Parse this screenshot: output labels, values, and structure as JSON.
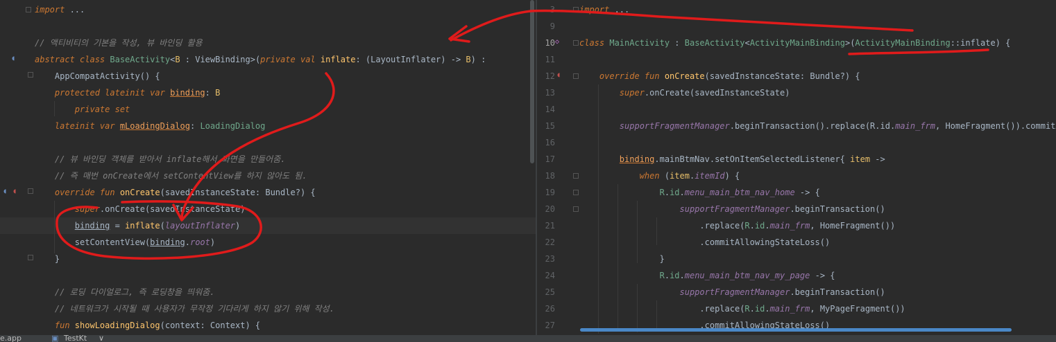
{
  "left_editor": {
    "lines": [
      [
        {
          "t": "import ",
          "c": "kw"
        },
        {
          "t": "...",
          "c": ""
        }
      ],
      [],
      [
        {
          "t": "// 액티비티의 기본을 작성, 뷰 바인딩 활용",
          "c": "cmt"
        }
      ],
      [
        {
          "t": "abstract class ",
          "c": "kw"
        },
        {
          "t": "BaseActivity",
          "c": "cls"
        },
        {
          "t": "<",
          "c": ""
        },
        {
          "t": "B",
          "c": "par"
        },
        {
          "t": " : ",
          "c": ""
        },
        {
          "t": "ViewBinding",
          "c": "typ"
        },
        {
          "t": ">(",
          "c": ""
        },
        {
          "t": "private val ",
          "c": "kw"
        },
        {
          "t": "inflate",
          "c": "fnc"
        },
        {
          "t": ": (",
          "c": ""
        },
        {
          "t": "LayoutInflater",
          "c": "typ"
        },
        {
          "t": ") -> ",
          "c": ""
        },
        {
          "t": "B",
          "c": "par"
        },
        {
          "t": ") :",
          "c": ""
        }
      ],
      [
        {
          "t": "    AppCompatActivity",
          "c": "typ"
        },
        {
          "t": "() {",
          "c": ""
        }
      ],
      [
        {
          "t": "    protected lateinit var ",
          "c": "kw"
        },
        {
          "t": "binding",
          "c": "field"
        },
        {
          "t": ": ",
          "c": ""
        },
        {
          "t": "B",
          "c": "par"
        }
      ],
      [
        {
          "t": "        private set",
          "c": "kw"
        }
      ],
      [
        {
          "t": "    lateinit var ",
          "c": "kw"
        },
        {
          "t": "mLoadingDialog",
          "c": "field"
        },
        {
          "t": ": ",
          "c": ""
        },
        {
          "t": "LoadingDialog",
          "c": "cls"
        }
      ],
      [],
      [
        {
          "t": "    // 뷰 바인딩 객체를 받아서 inflate해서 화면을 만들어줌.",
          "c": "cmt"
        }
      ],
      [
        {
          "t": "    // 즉 매번 onCreate에서 setContentView를 하지 않아도 됨.",
          "c": "cmt"
        }
      ],
      [
        {
          "t": "    override fun ",
          "c": "kw"
        },
        {
          "t": "onCreate",
          "c": "fnc"
        },
        {
          "t": "(",
          "c": ""
        },
        {
          "t": "savedInstanceState",
          "c": ""
        },
        {
          "t": ": ",
          "c": ""
        },
        {
          "t": "Bundle",
          "c": "typ"
        },
        {
          "t": "?) {",
          "c": ""
        }
      ],
      [
        {
          "t": "        super",
          "c": "kw"
        },
        {
          "t": ".onCreate(savedInstanceState)",
          "c": ""
        }
      ],
      [
        {
          "t": "        ",
          "c": ""
        },
        {
          "t": "binding",
          "c": "var"
        },
        {
          "t": " = ",
          "c": ""
        },
        {
          "t": "inflate",
          "c": "fnc"
        },
        {
          "t": "(",
          "c": ""
        },
        {
          "t": "layoutInflater",
          "c": "prop"
        },
        {
          "t": ")",
          "c": ""
        }
      ],
      [
        {
          "t": "        setContentView(",
          "c": ""
        },
        {
          "t": "binding",
          "c": "var"
        },
        {
          "t": ".",
          "c": ""
        },
        {
          "t": "root",
          "c": "prop"
        },
        {
          "t": ")",
          "c": ""
        }
      ],
      [
        {
          "t": "    }",
          "c": ""
        }
      ],
      [],
      [
        {
          "t": "    // 로딩 다이얼로그, 즉 로딩창을 띄워줌.",
          "c": "cmt"
        }
      ],
      [
        {
          "t": "    // 네트워크가 시작될 때 사용자가 무작정 기다리게 하지 않기 위해 작성.",
          "c": "cmt"
        }
      ],
      [
        {
          "t": "    fun ",
          "c": "kw"
        },
        {
          "t": "showLoadingDialog",
          "c": "fnc"
        },
        {
          "t": "(",
          "c": ""
        },
        {
          "t": "context",
          "c": ""
        },
        {
          "t": ": ",
          "c": ""
        },
        {
          "t": "Context",
          "c": "typ"
        },
        {
          "t": ") {",
          "c": ""
        }
      ]
    ]
  },
  "right_editor": {
    "line_numbers": [
      "3",
      "9",
      "10",
      "11",
      "12",
      "13",
      "14",
      "15",
      "16",
      "17",
      "18",
      "19",
      "20",
      "21",
      "22",
      "23",
      "24",
      "25",
      "26",
      "27"
    ],
    "lines": [
      [
        {
          "t": "import ",
          "c": "kw"
        },
        {
          "t": "...",
          "c": ""
        }
      ],
      [],
      [
        {
          "t": "class ",
          "c": "kw"
        },
        {
          "t": "MainActivity",
          "c": "cls"
        },
        {
          "t": " : ",
          "c": ""
        },
        {
          "t": "BaseActivity",
          "c": "cls"
        },
        {
          "t": "<",
          "c": ""
        },
        {
          "t": "ActivityMainBinding",
          "c": "cls"
        },
        {
          "t": ">(",
          "c": ""
        },
        {
          "t": "ActivityMainBinding",
          "c": "cls"
        },
        {
          "t": "::",
          "c": ""
        },
        {
          "t": "inflate",
          "c": ""
        },
        {
          "t": ") {",
          "c": ""
        }
      ],
      [],
      [
        {
          "t": "    override fun ",
          "c": "kw"
        },
        {
          "t": "onCreate",
          "c": "fnc"
        },
        {
          "t": "(savedInstanceState: ",
          "c": ""
        },
        {
          "t": "Bundle",
          "c": "typ"
        },
        {
          "t": "?) {",
          "c": ""
        }
      ],
      [
        {
          "t": "        super",
          "c": "kw"
        },
        {
          "t": ".onCreate(savedInstanceState)",
          "c": ""
        }
      ],
      [],
      [
        {
          "t": "        supportFragmentManager",
          "c": "prop"
        },
        {
          "t": ".beginTransaction().replace(",
          "c": ""
        },
        {
          "t": "R",
          "c": ""
        },
        {
          "t": ".",
          "c": ""
        },
        {
          "t": "id",
          "c": ""
        },
        {
          "t": ".",
          "c": ""
        },
        {
          "t": "main_frm",
          "c": "prop"
        },
        {
          "t": ", ",
          "c": ""
        },
        {
          "t": "HomeFragment",
          "c": "typ"
        },
        {
          "t": "()).commitAll",
          "c": ""
        }
      ],
      [],
      [
        {
          "t": "        ",
          "c": ""
        },
        {
          "t": "binding",
          "c": "field"
        },
        {
          "t": ".mainBtmNav.setOnItemSelectedListener{ ",
          "c": ""
        },
        {
          "t": "item",
          "c": "par"
        },
        {
          "t": " ->",
          "c": ""
        }
      ],
      [
        {
          "t": "            when ",
          "c": "kw"
        },
        {
          "t": "(",
          "c": ""
        },
        {
          "t": "item",
          "c": "par"
        },
        {
          "t": ".",
          "c": ""
        },
        {
          "t": "itemId",
          "c": "prop"
        },
        {
          "t": ") {",
          "c": ""
        }
      ],
      [
        {
          "t": "                R",
          "c": "cls"
        },
        {
          "t": ".",
          "c": ""
        },
        {
          "t": "id",
          "c": "cls"
        },
        {
          "t": ".",
          "c": ""
        },
        {
          "t": "menu_main_btm_nav_home",
          "c": "prop"
        },
        {
          "t": " -> {",
          "c": ""
        }
      ],
      [
        {
          "t": "                    supportFragmentManager",
          "c": "prop"
        },
        {
          "t": ".beginTransaction()",
          "c": ""
        }
      ],
      [
        {
          "t": "                        .replace(",
          "c": ""
        },
        {
          "t": "R",
          "c": "cls"
        },
        {
          "t": ".",
          "c": ""
        },
        {
          "t": "id",
          "c": "cls"
        },
        {
          "t": ".",
          "c": ""
        },
        {
          "t": "main_frm",
          "c": "prop"
        },
        {
          "t": ", ",
          "c": ""
        },
        {
          "t": "HomeFragment",
          "c": "typ"
        },
        {
          "t": "())",
          "c": ""
        }
      ],
      [
        {
          "t": "                        .commitAllowingStateLoss()",
          "c": ""
        }
      ],
      [
        {
          "t": "                }",
          "c": ""
        }
      ],
      [
        {
          "t": "                R",
          "c": "cls"
        },
        {
          "t": ".",
          "c": ""
        },
        {
          "t": "id",
          "c": "cls"
        },
        {
          "t": ".",
          "c": ""
        },
        {
          "t": "menu_main_btm_nav_my_page",
          "c": "prop"
        },
        {
          "t": " -> {",
          "c": ""
        }
      ],
      [
        {
          "t": "                    supportFragmentManager",
          "c": "prop"
        },
        {
          "t": ".beginTransaction()",
          "c": ""
        }
      ],
      [
        {
          "t": "                        .replace(",
          "c": ""
        },
        {
          "t": "R",
          "c": "cls"
        },
        {
          "t": ".",
          "c": ""
        },
        {
          "t": "id",
          "c": "cls"
        },
        {
          "t": ".",
          "c": ""
        },
        {
          "t": "main_frm",
          "c": "prop"
        },
        {
          "t": ", ",
          "c": ""
        },
        {
          "t": "MyPageFragment",
          "c": "typ"
        },
        {
          "t": "())",
          "c": ""
        }
      ],
      [
        {
          "t": "                        .commitAllowingStateLoss()",
          "c": ""
        }
      ]
    ]
  },
  "status_bar": {
    "left_item": "e.app",
    "tab_label": "TestKt",
    "tab_chevron": "∨"
  },
  "annotation": {
    "color": "#e01b1b"
  }
}
